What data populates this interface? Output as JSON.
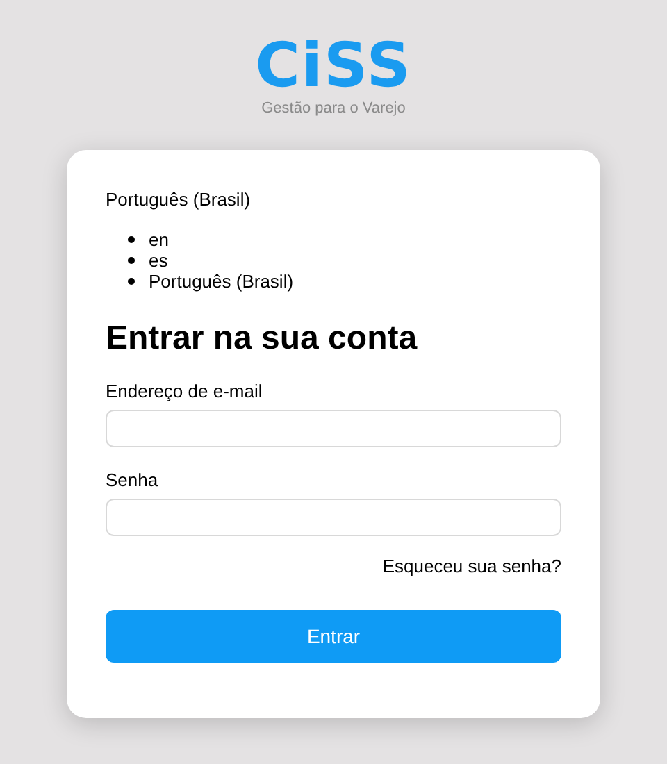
{
  "logo": {
    "wordmark": "CiSS",
    "tagline": "Gestão para o Varejo"
  },
  "language": {
    "current": "Português (Brasil)",
    "options": [
      {
        "label": "en"
      },
      {
        "label": "es"
      },
      {
        "label": "Português (Brasil)"
      }
    ]
  },
  "heading": "Entrar na sua conta",
  "fields": [
    {
      "label": "Endereço de e-mail"
    },
    {
      "label": "Senha"
    }
  ],
  "forgot_link": "Esqueceu sua senha?",
  "submit": "Entrar"
}
